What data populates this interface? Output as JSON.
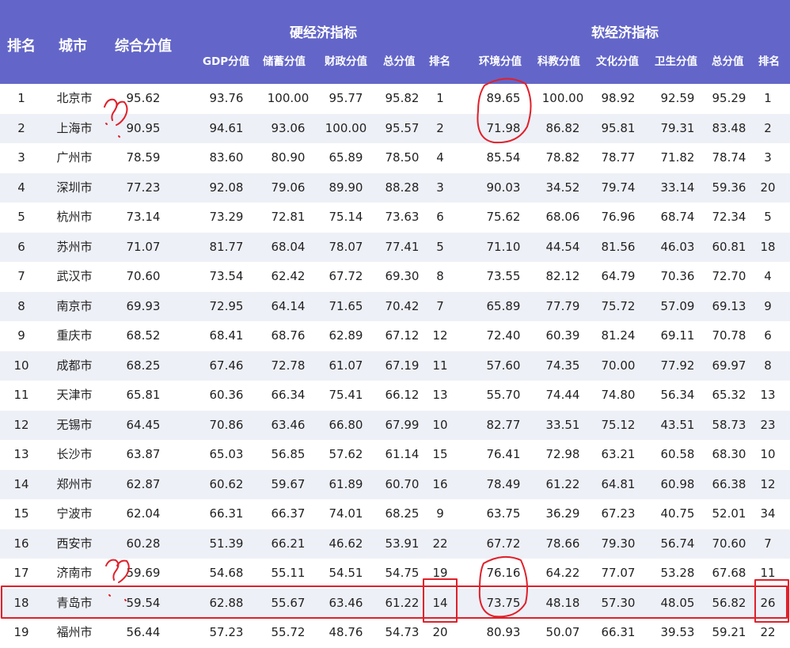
{
  "header": {
    "rank": "排名",
    "city": "城市",
    "composite": "综合分值",
    "hard_group": "硬经济指标",
    "soft_group": "软经济指标",
    "hard_cols": [
      "GDP分值",
      "储蓄分值",
      "财政分值",
      "总分值",
      "排名"
    ],
    "soft_cols": [
      "环境分值",
      "科教分值",
      "文化分值",
      "卫生分值",
      "总分值",
      "排名"
    ]
  },
  "rows": [
    [
      "1",
      "北京市",
      "95.62",
      "93.76",
      "100.00",
      "95.77",
      "95.82",
      "1",
      "89.65",
      "100.00",
      "98.92",
      "92.59",
      "95.29",
      "1"
    ],
    [
      "2",
      "上海市",
      "90.95",
      "94.61",
      "93.06",
      "100.00",
      "95.57",
      "2",
      "71.98",
      "86.82",
      "95.81",
      "79.31",
      "83.48",
      "2"
    ],
    [
      "3",
      "广州市",
      "78.59",
      "83.60",
      "80.90",
      "65.89",
      "78.50",
      "4",
      "85.54",
      "78.82",
      "78.77",
      "71.82",
      "78.74",
      "3"
    ],
    [
      "4",
      "深圳市",
      "77.23",
      "92.08",
      "79.06",
      "89.90",
      "88.28",
      "3",
      "90.03",
      "34.52",
      "79.74",
      "33.14",
      "59.36",
      "20"
    ],
    [
      "5",
      "杭州市",
      "73.14",
      "73.29",
      "72.81",
      "75.14",
      "73.63",
      "6",
      "75.62",
      "68.06",
      "76.96",
      "68.74",
      "72.34",
      "5"
    ],
    [
      "6",
      "苏州市",
      "71.07",
      "81.77",
      "68.04",
      "78.07",
      "77.41",
      "5",
      "71.10",
      "44.54",
      "81.56",
      "46.03",
      "60.81",
      "18"
    ],
    [
      "7",
      "武汉市",
      "70.60",
      "73.54",
      "62.42",
      "67.72",
      "69.30",
      "8",
      "73.55",
      "82.12",
      "64.79",
      "70.36",
      "72.70",
      "4"
    ],
    [
      "8",
      "南京市",
      "69.93",
      "72.95",
      "64.14",
      "71.65",
      "70.42",
      "7",
      "65.89",
      "77.79",
      "75.72",
      "57.09",
      "69.13",
      "9"
    ],
    [
      "9",
      "重庆市",
      "68.52",
      "68.41",
      "68.76",
      "62.89",
      "67.12",
      "12",
      "72.40",
      "60.39",
      "81.24",
      "69.11",
      "70.78",
      "6"
    ],
    [
      "10",
      "成都市",
      "68.25",
      "67.46",
      "72.78",
      "61.07",
      "67.19",
      "11",
      "57.60",
      "74.35",
      "70.00",
      "77.92",
      "69.97",
      "8"
    ],
    [
      "11",
      "天津市",
      "65.81",
      "60.36",
      "66.34",
      "75.41",
      "66.12",
      "13",
      "55.70",
      "74.44",
      "74.80",
      "56.34",
      "65.32",
      "13"
    ],
    [
      "12",
      "无锡市",
      "64.45",
      "70.86",
      "63.46",
      "66.80",
      "67.99",
      "10",
      "82.77",
      "33.51",
      "75.12",
      "43.51",
      "58.73",
      "23"
    ],
    [
      "13",
      "长沙市",
      "63.87",
      "65.03",
      "56.85",
      "57.62",
      "61.14",
      "15",
      "76.41",
      "72.98",
      "63.21",
      "60.58",
      "68.30",
      "10"
    ],
    [
      "14",
      "郑州市",
      "62.87",
      "60.62",
      "59.67",
      "61.89",
      "60.70",
      "16",
      "78.49",
      "61.22",
      "64.81",
      "60.98",
      "66.38",
      "12"
    ],
    [
      "15",
      "宁波市",
      "62.04",
      "66.31",
      "66.37",
      "74.01",
      "68.25",
      "9",
      "63.75",
      "36.29",
      "67.23",
      "40.75",
      "52.01",
      "34"
    ],
    [
      "16",
      "西安市",
      "60.28",
      "51.39",
      "66.21",
      "46.62",
      "53.91",
      "22",
      "67.72",
      "78.66",
      "79.30",
      "56.74",
      "70.60",
      "7"
    ],
    [
      "17",
      "济南市",
      "59.69",
      "54.68",
      "55.11",
      "54.51",
      "54.75",
      "19",
      "76.16",
      "64.22",
      "77.07",
      "53.28",
      "67.68",
      "11"
    ],
    [
      "18",
      "青岛市",
      "59.54",
      "62.88",
      "55.67",
      "63.46",
      "61.22",
      "14",
      "73.75",
      "48.18",
      "57.30",
      "48.05",
      "56.82",
      "26"
    ],
    [
      "19",
      "福州市",
      "56.44",
      "57.23",
      "55.72",
      "48.76",
      "54.73",
      "20",
      "80.93",
      "50.07",
      "66.31",
      "39.53",
      "59.21",
      "22"
    ]
  ],
  "colors": {
    "header_bg": "#6366c8",
    "stripe": "#eef0f7",
    "annotation": "#e0202a"
  }
}
